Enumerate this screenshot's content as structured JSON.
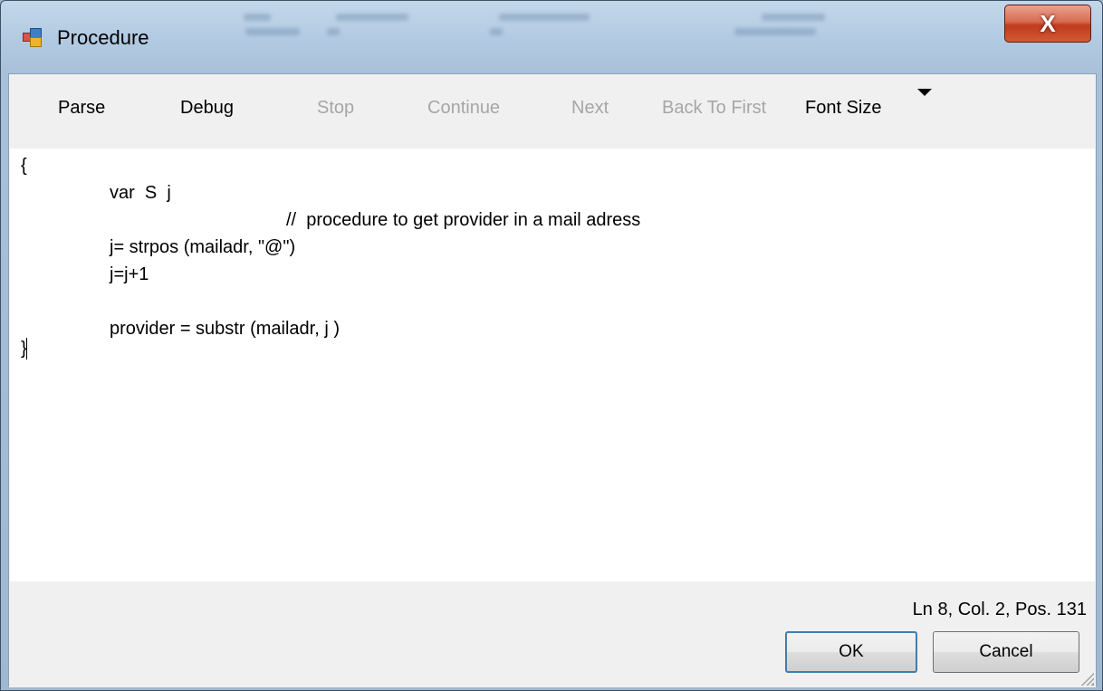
{
  "window": {
    "title": "Procedure",
    "close_symbol": "X"
  },
  "toolbar": {
    "items": [
      {
        "label": "Parse",
        "enabled": true
      },
      {
        "label": "Debug",
        "enabled": true
      },
      {
        "label": "Stop",
        "enabled": false
      },
      {
        "label": "Continue",
        "enabled": false
      },
      {
        "label": "Next",
        "enabled": false
      },
      {
        "label": "Back To First",
        "enabled": false
      },
      {
        "label": "Font Size",
        "enabled": true
      }
    ]
  },
  "editor": {
    "lines": [
      "{",
      "var  S  j",
      "//  procedure to get provider in a mail adress",
      "j= strpos (mailadr, \"@\")",
      "j=j+1",
      "",
      "provider = substr (mailadr, j )",
      "}"
    ]
  },
  "status": {
    "text": "Ln 8, Col. 2, Pos. 131"
  },
  "buttons": {
    "ok": "OK",
    "cancel": "Cancel"
  }
}
